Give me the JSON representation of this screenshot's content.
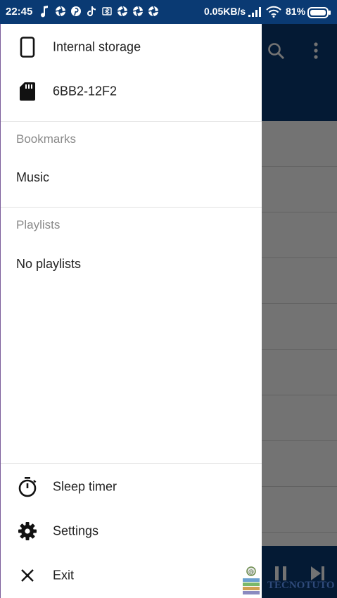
{
  "status_bar": {
    "time": "22:45",
    "network_speed": "0.05KB/s",
    "battery_percent": "81%",
    "notification_icons": [
      "music-note-icon",
      "aperture-icon",
      "pinterest-icon",
      "tiktok-icon",
      "bluetooth-icon",
      "aperture-icon",
      "aperture-icon",
      "aperture-icon"
    ]
  },
  "drawer": {
    "storage": [
      {
        "label": "Internal storage",
        "icon": "phone-icon"
      },
      {
        "label": "6BB2-12F2",
        "icon": "sd-card-icon"
      }
    ],
    "bookmarks": {
      "header": "Bookmarks",
      "items": [
        "Music"
      ]
    },
    "playlists": {
      "header": "Playlists",
      "empty_text": "No playlists"
    },
    "bottom": [
      {
        "label": "Sleep timer",
        "icon": "timer-icon"
      },
      {
        "label": "Settings",
        "icon": "gear-icon"
      },
      {
        "label": "Exit",
        "icon": "close-icon"
      }
    ]
  },
  "watermark": {
    "text": "TECNOTUTO"
  }
}
